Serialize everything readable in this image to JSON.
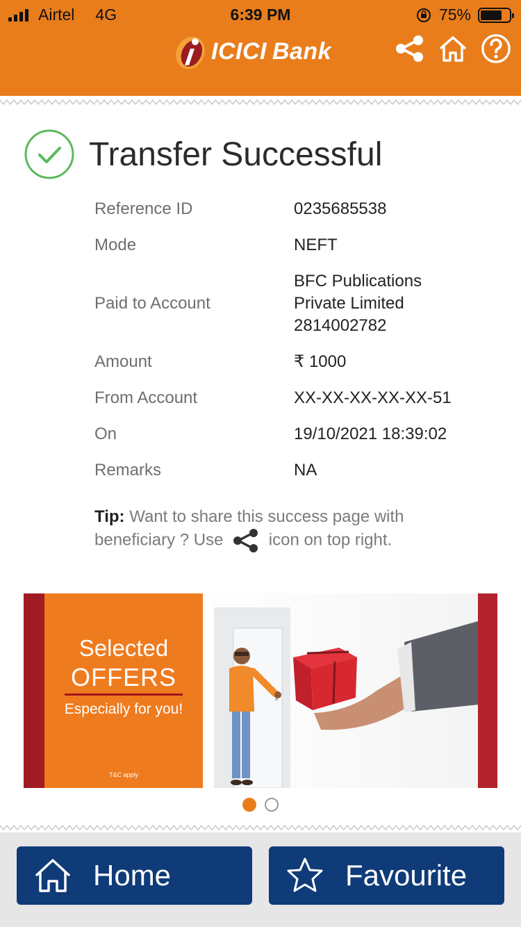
{
  "status_bar": {
    "carrier": "Airtel",
    "network": "4G",
    "time": "6:39 PM",
    "battery": "75%",
    "battery_level": 0.75
  },
  "header": {
    "brand": "ICICI",
    "brand_suffix": "Bank",
    "icons": [
      "share-icon",
      "home-icon",
      "help-icon"
    ]
  },
  "result": {
    "title": "Transfer Successful"
  },
  "details": {
    "reference_id": {
      "label": "Reference ID",
      "value": "0235685538"
    },
    "mode": {
      "label": "Mode",
      "value": "NEFT"
    },
    "paid_to": {
      "label": "Paid to Account",
      "value": "BFC Publications\nPrivate Limited\n2814002782"
    },
    "amount": {
      "label": "Amount",
      "value": "₹ 1000"
    },
    "from_account": {
      "label": "From Account",
      "value": "XX-XX-XX-XX-XX-51"
    },
    "on": {
      "label": "On",
      "value": "19/10/2021 18:39:02"
    },
    "remarks": {
      "label": "Remarks",
      "value": "NA"
    }
  },
  "tip": {
    "label": "Tip:",
    "text_before": " Want to share this success page with beneficiary ? Use ",
    "text_after": " icon on top right."
  },
  "banner": {
    "line1": "Selected",
    "line2": "OFFERS",
    "line3": "Especially for you!",
    "tnc": "T&C apply",
    "slides": 2,
    "active_slide": 1
  },
  "footer": {
    "home_label": "Home",
    "favourite_label": "Favourite"
  },
  "colors": {
    "header_orange": "#e97d1c",
    "success_green": "#5cb85c",
    "footer_button_blue": "#0f3b78",
    "banner_maroon": "#a01b24"
  }
}
